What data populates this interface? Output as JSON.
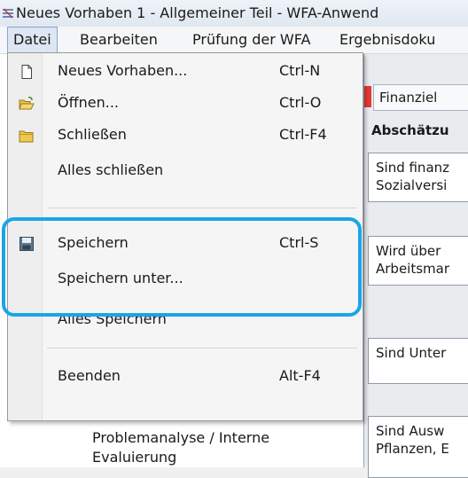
{
  "window": {
    "title": "Neues Vorhaben 1 - Allgemeiner Teil - WFA-Anwend"
  },
  "menubar": {
    "items": [
      {
        "label": "Datei"
      },
      {
        "label": "Bearbeiten"
      },
      {
        "label": "Prüfung der WFA"
      },
      {
        "label": "Ergebnisdoku"
      }
    ]
  },
  "file_menu": {
    "items": [
      {
        "label": "Neues Vorhaben...",
        "shortcut": "Ctrl-N",
        "icon": "new-document-icon"
      },
      {
        "label": "Öffnen...",
        "shortcut": "Ctrl-O",
        "icon": "open-folder-icon"
      },
      {
        "label": "Schließen",
        "shortcut": "Ctrl-F4",
        "icon": "close-folder-icon"
      },
      {
        "label": "Alles schließen",
        "shortcut": ""
      },
      {
        "label": "Speichern",
        "shortcut": "Ctrl-S",
        "icon": "save-disk-icon"
      },
      {
        "label": "Speichern unter...",
        "shortcut": ""
      },
      {
        "label": "Alles Speichern",
        "shortcut": ""
      },
      {
        "label": "Beenden",
        "shortcut": "Alt-F4"
      }
    ]
  },
  "tree": {
    "node_line1": "Problemanalyse / Interne",
    "node_line2": "Evaluierung"
  },
  "right_panel": {
    "tab_label": "Finanziel",
    "section_title": "Abschätzu",
    "questions": [
      {
        "line1": "Sind finanz",
        "line2": "Sozialversi"
      },
      {
        "line1": "Wird über",
        "line2": "Arbeitsmar"
      },
      {
        "line1": "Sind Unter",
        "line2": ""
      },
      {
        "line1": "Sind Ausw",
        "line2": "Pflanzen, E"
      }
    ]
  },
  "colors": {
    "highlight": "#1aa5e8",
    "tab_marker": "#e53935"
  }
}
